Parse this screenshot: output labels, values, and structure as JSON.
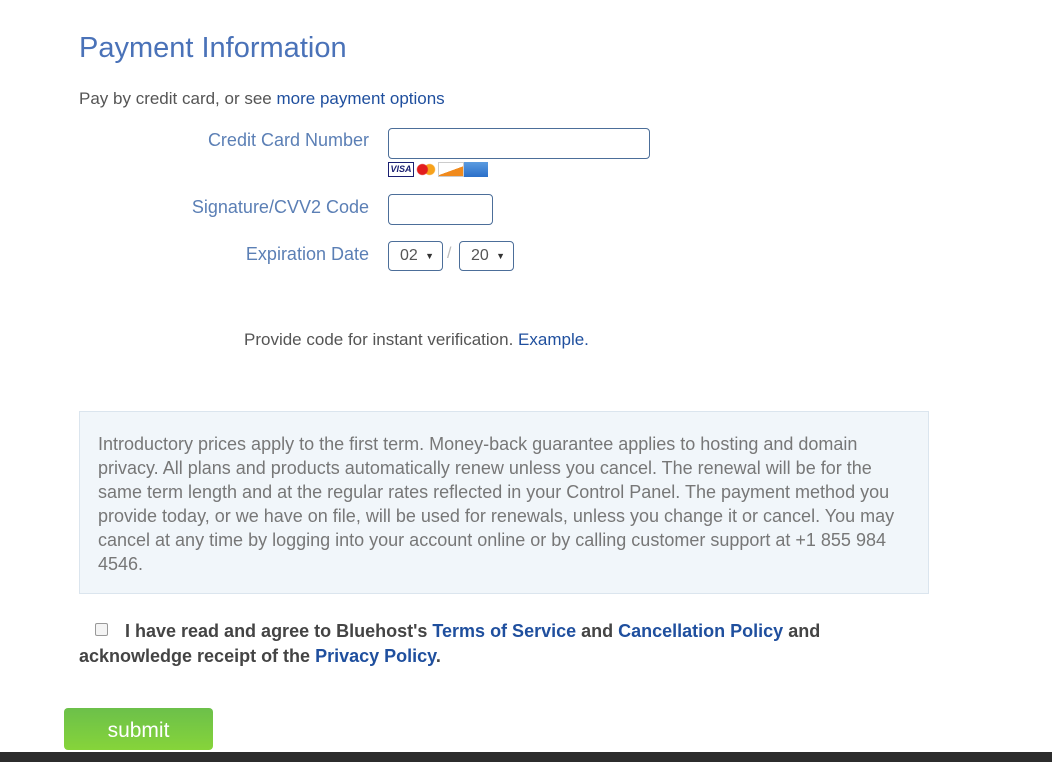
{
  "title": "Payment Information",
  "subtitle": {
    "text": "Pay by credit card, or see ",
    "link": "more payment options"
  },
  "form": {
    "card_label": "Credit Card Number",
    "card_value": "",
    "card_icons": [
      "visa-icon",
      "mastercard-icon",
      "discover-icon",
      "amex-icon"
    ],
    "cvv_label": "Signature/CVV2 Code",
    "cvv_value": "",
    "exp_label": "Expiration Date",
    "exp_month": "02",
    "exp_sep": "/",
    "exp_year": "20"
  },
  "verify": {
    "text": "Provide code for instant verification. ",
    "link": "Example."
  },
  "notice": "Introductory prices apply to the first term. Money-back guarantee applies to hosting and domain privacy. All plans and products automatically renew unless you cancel. The renewal will be for the same term length and at the regular rates reflected in your Control Panel. The payment method you provide today, or we have on file, will be used for renewals, unless you change it or cancel. You may cancel at any time by logging into your account online or by calling customer support at +1 855 984 4546.",
  "agree": {
    "t1": "I have read and agree to Bluehost's ",
    "tos": "Terms of Service",
    "t2": " and ",
    "cancel": "Cancellation Policy",
    "t3": " and acknowledge receipt of the ",
    "privacy": "Privacy Policy",
    "t4": "."
  },
  "submit": "submit",
  "colors": {
    "title": "#4a72b8",
    "link": "#1f4f9e",
    "submit": "#7ccb40",
    "footer": "#2c2c2c"
  }
}
